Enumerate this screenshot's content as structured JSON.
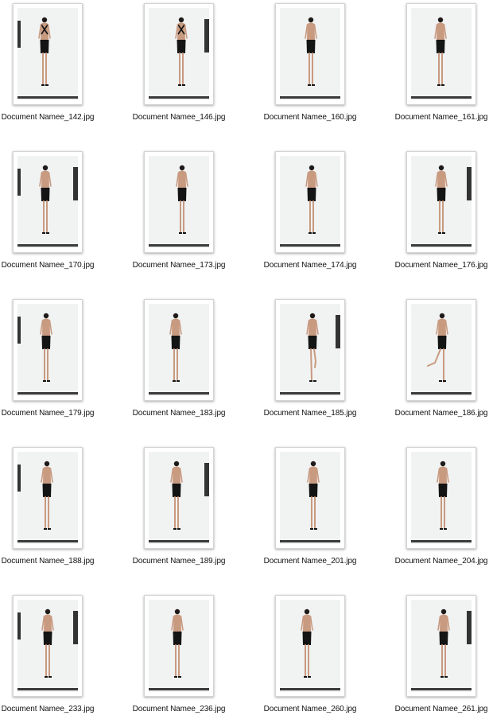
{
  "files": [
    {
      "name": "Document Namee_142.jpg",
      "pose": "front-straps"
    },
    {
      "name": "Document Namee_146.jpg",
      "pose": "front-straps"
    },
    {
      "name": "Document Namee_160.jpg",
      "pose": "back"
    },
    {
      "name": "Document Namee_161.jpg",
      "pose": "back"
    },
    {
      "name": "Document Namee_170.jpg",
      "pose": "back"
    },
    {
      "name": "Document Namee_173.jpg",
      "pose": "back"
    },
    {
      "name": "Document Namee_174.jpg",
      "pose": "back"
    },
    {
      "name": "Document Namee_176.jpg",
      "pose": "back"
    },
    {
      "name": "Document Namee_179.jpg",
      "pose": "back"
    },
    {
      "name": "Document Namee_183.jpg",
      "pose": "back"
    },
    {
      "name": "Document Namee_185.jpg",
      "pose": "back-leg-up"
    },
    {
      "name": "Document Namee_186.jpg",
      "pose": "back-kick"
    },
    {
      "name": "Document Namee_188.jpg",
      "pose": "back"
    },
    {
      "name": "Document Namee_189.jpg",
      "pose": "back"
    },
    {
      "name": "Document Namee_201.jpg",
      "pose": "back"
    },
    {
      "name": "Document Namee_204.jpg",
      "pose": "back"
    },
    {
      "name": "Document Namee_233.jpg",
      "pose": "back"
    },
    {
      "name": "Document Namee_236.jpg",
      "pose": "back"
    },
    {
      "name": "Document Namee_260.jpg",
      "pose": "back"
    },
    {
      "name": "Document Namee_261.jpg",
      "pose": "back"
    }
  ],
  "colors": {
    "backdrop": "#e9eaea",
    "floor": "#3a3a3a",
    "skin": "#c89a80",
    "skirt": "#141414",
    "hair": "#1e1a18"
  }
}
